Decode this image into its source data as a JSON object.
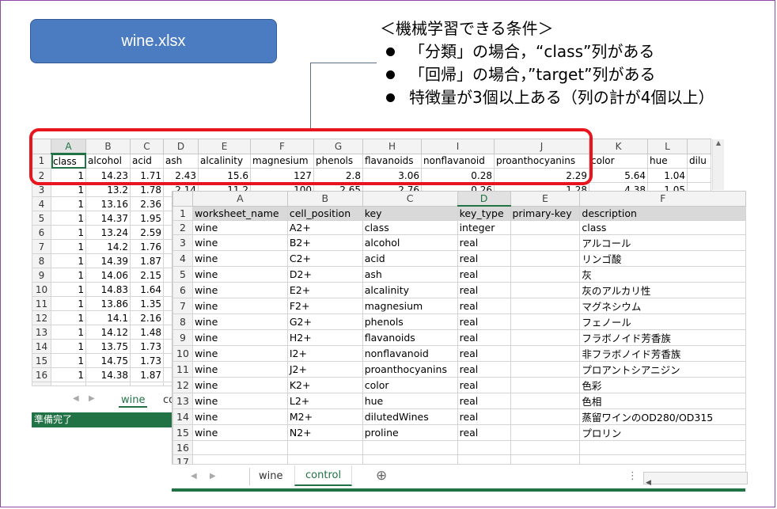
{
  "title": "wine.xlsx",
  "conditions": {
    "heading": "＜機械学習できる条件＞",
    "items": [
      "「分類」の場合，“class”列がある",
      "「回帰」の場合，”target”列がある",
      "特徴量が3個以上ある（列の計が4個以上）"
    ]
  },
  "sheet1": {
    "columns": [
      "A",
      "B",
      "C",
      "D",
      "E",
      "F",
      "G",
      "H",
      "I",
      "J",
      "K",
      "L"
    ],
    "header_row": [
      "class",
      "alcohol",
      "acid",
      "ash",
      "alcalinity",
      "magnesium",
      "phenols",
      "flavanoids",
      "nonflavanoid",
      "proanthocyanins",
      "color",
      "hue",
      "dilu"
    ],
    "rows": [
      [
        "1",
        "14.23",
        "1.71",
        "2.43",
        "15.6",
        "127",
        "2.8",
        "3.06",
        "0.28",
        "2.29",
        "5.64",
        "1.04"
      ],
      [
        "1",
        "13.2",
        "1.78",
        "2.14",
        "11.2",
        "100",
        "2.65",
        "2.76",
        "0.26",
        "1.28",
        "4.38",
        "1.05"
      ],
      [
        "1",
        "13.16",
        "2.36"
      ],
      [
        "1",
        "14.37",
        "1.95"
      ],
      [
        "1",
        "13.24",
        "2.59"
      ],
      [
        "1",
        "14.2",
        "1.76"
      ],
      [
        "1",
        "14.39",
        "1.87"
      ],
      [
        "1",
        "14.06",
        "2.15"
      ],
      [
        "1",
        "14.83",
        "1.64"
      ],
      [
        "1",
        "13.86",
        "1.35"
      ],
      [
        "1",
        "14.1",
        "2.16"
      ],
      [
        "1",
        "14.12",
        "1.48"
      ],
      [
        "1",
        "13.75",
        "1.73"
      ],
      [
        "1",
        "14.75",
        "1.73"
      ],
      [
        "1",
        "14.38",
        "1.87"
      ],
      [
        "1",
        "13.63",
        "1.81"
      ]
    ],
    "tabs": [
      "wine",
      "co"
    ],
    "status": "準備完了"
  },
  "sheet2": {
    "columns": [
      "A",
      "B",
      "C",
      "D",
      "E",
      "F"
    ],
    "rows": [
      [
        "worksheet_name",
        "cell_position",
        "key",
        "key_type",
        "primary-key",
        "description"
      ],
      [
        "wine",
        "A2+",
        "class",
        "integer",
        "",
        "class"
      ],
      [
        "wine",
        "B2+",
        "alcohol",
        "real",
        "",
        "アルコール"
      ],
      [
        "wine",
        "C2+",
        "acid",
        "real",
        "",
        "リンゴ酸"
      ],
      [
        "wine",
        "D2+",
        "ash",
        "real",
        "",
        "灰"
      ],
      [
        "wine",
        "E2+",
        "alcalinity",
        "real",
        "",
        "灰のアルカリ性"
      ],
      [
        "wine",
        "F2+",
        "magnesium",
        "real",
        "",
        "マグネシウム"
      ],
      [
        "wine",
        "G2+",
        "phenols",
        "real",
        "",
        "フェノール"
      ],
      [
        "wine",
        "H2+",
        "flavanoids",
        "real",
        "",
        "フラボノイド芳香族"
      ],
      [
        "wine",
        "I2+",
        "nonflavanoid",
        "real",
        "",
        "非フラボノイド芳香族"
      ],
      [
        "wine",
        "J2+",
        "proanthocyanins",
        "real",
        "",
        "プロアントシアニジン"
      ],
      [
        "wine",
        "K2+",
        "color",
        "real",
        "",
        "色彩"
      ],
      [
        "wine",
        "L2+",
        "hue",
        "real",
        "",
        "色相"
      ],
      [
        "wine",
        "M2+",
        "dilutedWines",
        "real",
        "",
        "蒸留ワインのOD280/OD315"
      ],
      [
        "wine",
        "N2+",
        "proline",
        "real",
        "",
        "プロリン"
      ],
      [
        "",
        "",
        "",
        "",
        "",
        ""
      ],
      [
        "",
        "",
        "",
        "",
        "",
        ""
      ],
      [
        "",
        "",
        "",
        "",
        "",
        ""
      ]
    ],
    "tabs": [
      "wine",
      "control"
    ],
    "add_sheet": "⊕"
  },
  "colors": {
    "excel_green": "#217346",
    "title_blue": "#4b7bc1",
    "highlight_red": "#e8141e"
  }
}
